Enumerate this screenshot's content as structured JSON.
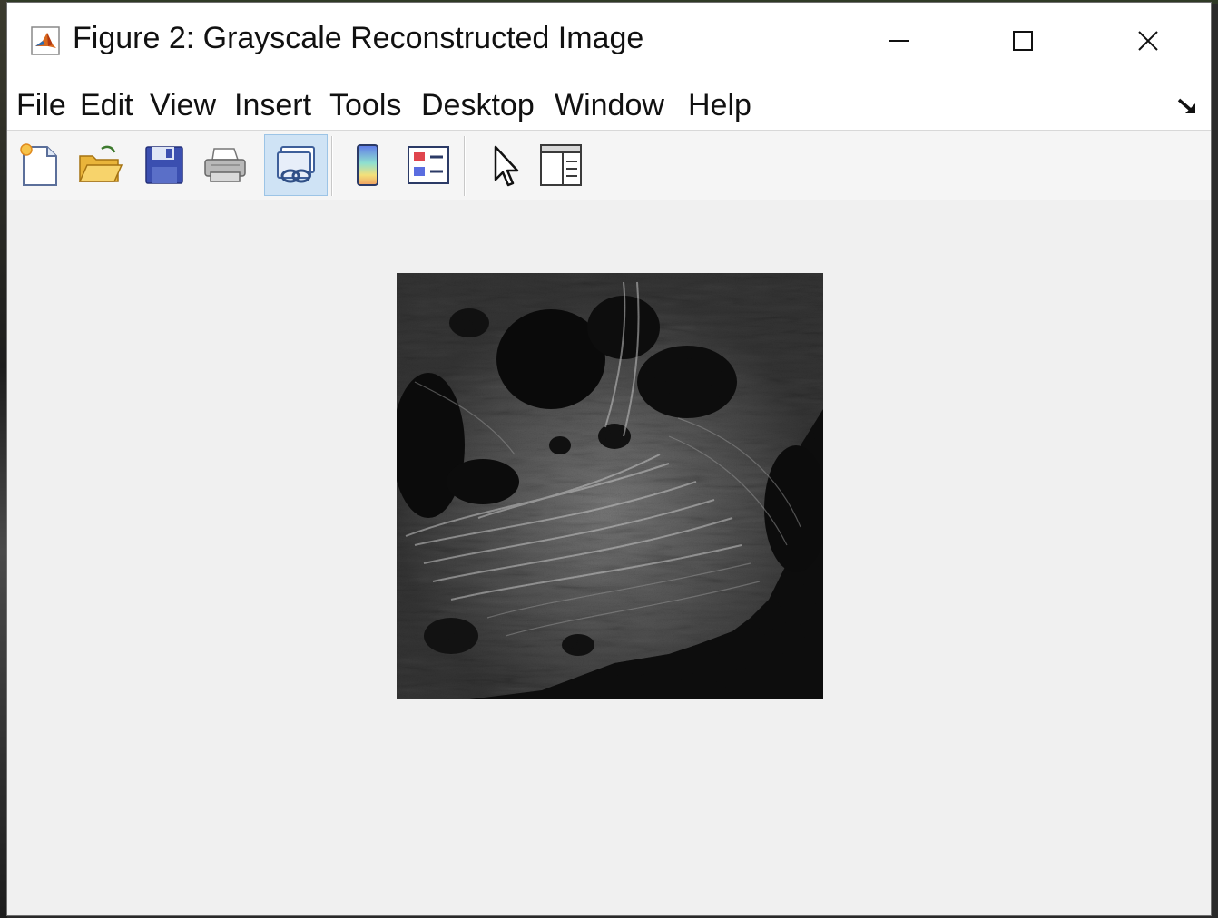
{
  "window": {
    "title": "Figure 2: Grayscale Reconstructed Image",
    "controls": {
      "minimize_icon": "minimize-icon",
      "maximize_icon": "maximize-icon",
      "close_icon": "close-icon"
    }
  },
  "menubar": {
    "items": [
      {
        "label": "File"
      },
      {
        "label": "Edit"
      },
      {
        "label": "View"
      },
      {
        "label": "Insert"
      },
      {
        "label": "Tools"
      },
      {
        "label": "Desktop"
      },
      {
        "label": "Window"
      },
      {
        "label": "Help"
      }
    ]
  },
  "toolbar": {
    "buttons": [
      {
        "icon": "new-figure-icon"
      },
      {
        "icon": "open-file-icon"
      },
      {
        "icon": "save-icon"
      },
      {
        "icon": "print-icon"
      },
      {
        "icon": "link-plot-icon",
        "active": true
      },
      {
        "icon": "colorbar-icon"
      },
      {
        "icon": "legend-icon"
      },
      {
        "icon": "edit-plot-pointer-icon"
      },
      {
        "icon": "property-inspector-icon"
      }
    ]
  },
  "figure": {
    "content": "grayscale-microscopy-image"
  },
  "colors": {
    "window_bg": "#f0f0f0",
    "titlebar_bg": "#ffffff",
    "active_button": "#cfe3f5",
    "image_bg": "#0d0d0d"
  }
}
